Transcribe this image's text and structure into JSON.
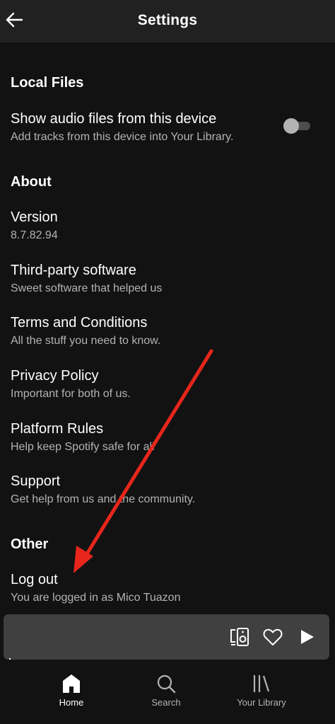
{
  "header": {
    "title": "Settings",
    "back_icon": "arrow-left-icon"
  },
  "local_files": {
    "heading": "Local Files",
    "show_audio": {
      "title": "Show audio files from this device",
      "subtitle": "Add tracks from this device into Your Library.",
      "toggle_on": false
    }
  },
  "about": {
    "heading": "About",
    "items": [
      {
        "title": "Version",
        "subtitle": "8.7.82.94"
      },
      {
        "title": "Third-party software",
        "subtitle": "Sweet software that helped us"
      },
      {
        "title": "Terms and Conditions",
        "subtitle": "All the stuff you need to know."
      },
      {
        "title": "Privacy Policy",
        "subtitle": "Important for both of us."
      },
      {
        "title": "Platform Rules",
        "subtitle": "Help keep Spotify safe for all"
      },
      {
        "title": "Support",
        "subtitle": "Get help from us and the community."
      }
    ]
  },
  "other": {
    "heading": "Other",
    "logout": {
      "title": "Log out",
      "subtitle": "You are logged in as Mico Tuazon"
    }
  },
  "player": {
    "icons": [
      "devices-icon",
      "heart-icon",
      "play-icon"
    ]
  },
  "tabs": [
    {
      "label": "Home",
      "icon": "home-icon",
      "active": true
    },
    {
      "label": "Search",
      "icon": "search-icon",
      "active": false
    },
    {
      "label": "Your Library",
      "icon": "library-icon",
      "active": false
    }
  ],
  "colors": {
    "background": "#121212",
    "header": "#212121",
    "player": "#404040",
    "subtext": "#b3b3b3",
    "annotation_arrow": "#e8261c"
  }
}
